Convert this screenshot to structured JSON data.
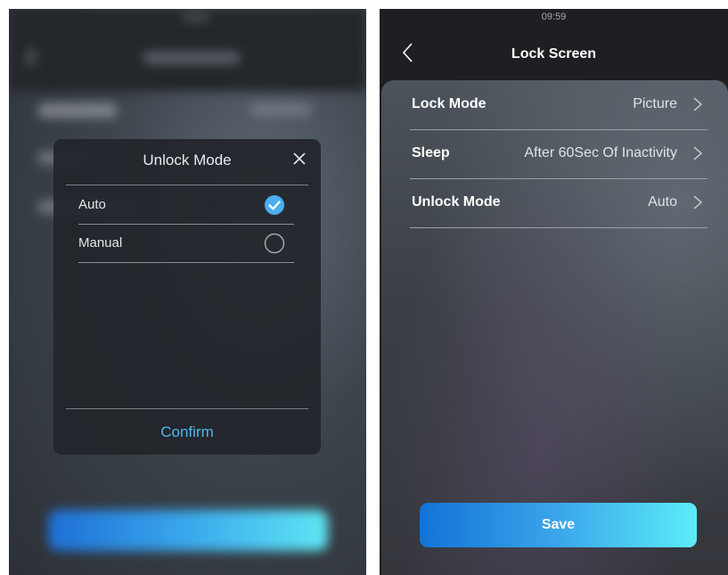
{
  "left_screen": {
    "dialog": {
      "title": "Unlock Mode",
      "options": [
        {
          "label": "Auto",
          "selected": true
        },
        {
          "label": "Manual",
          "selected": false
        }
      ],
      "confirm_label": "Confirm"
    }
  },
  "right_screen": {
    "status_time": "09:59",
    "title": "Lock Screen",
    "settings": [
      {
        "label": "Lock Mode",
        "value": "Picture"
      },
      {
        "label": "Sleep",
        "value": "After 60Sec Of Inactivity"
      },
      {
        "label": "Unlock Mode",
        "value": "Auto"
      }
    ],
    "save_label": "Save"
  },
  "colors": {
    "accent": "#4fb6f2",
    "check_fill": "#4aaef0",
    "save_gradient_start": "#1273d6",
    "save_gradient_end": "#5cecf8"
  },
  "icons": {
    "close": "close-icon",
    "back": "back-chevron-icon",
    "row_chevron": "chevron-right-icon",
    "checked": "check-circle-icon",
    "unchecked": "radio-empty-icon"
  }
}
